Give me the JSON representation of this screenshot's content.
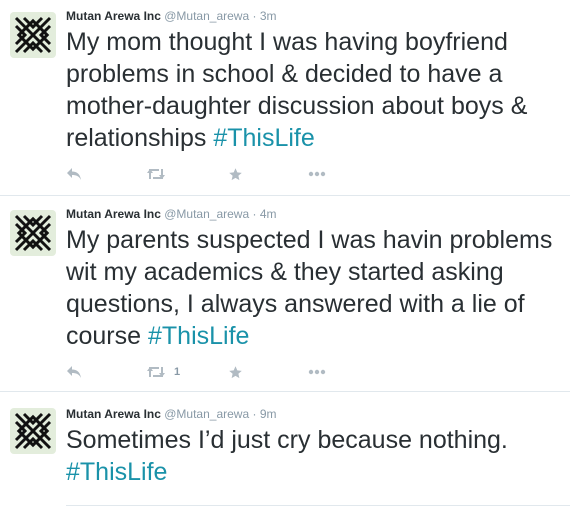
{
  "tweets": [
    {
      "name": "Mutan Arewa Inc",
      "handle": "@Mutan_arewa",
      "separator": "·",
      "time": "3m",
      "text": "My mom thought I was having boyfriend problems in school & decided to have a mother-daughter discussion about boys & relationships ",
      "hashtag": "#ThisLife",
      "retweets": ""
    },
    {
      "name": "Mutan Arewa Inc",
      "handle": "@Mutan_arewa",
      "separator": "·",
      "time": "4m",
      "text": "My parents suspected I was havin problems wit my academics & they started asking questions, I always answered with a lie of course ",
      "hashtag": "#ThisLife",
      "retweets": "1"
    },
    {
      "name": "Mutan Arewa Inc",
      "handle": "@Mutan_arewa",
      "separator": "·",
      "time": "9m",
      "text": "Sometimes I’d just cry because nothing. ",
      "hashtag": "#ThisLife",
      "retweets": ""
    }
  ],
  "icons": {
    "avatar": "knot-emblem-icon",
    "reply": "reply-icon",
    "retweet": "retweet-icon",
    "favorite": "star-icon",
    "more": "more-icon"
  },
  "colors": {
    "hashtag": "#1a92a9",
    "meta": "#8899a6",
    "action_icon": "#b1bbc3",
    "divider": "#e1e8ed",
    "avatar_bg": "#e3eddc"
  }
}
